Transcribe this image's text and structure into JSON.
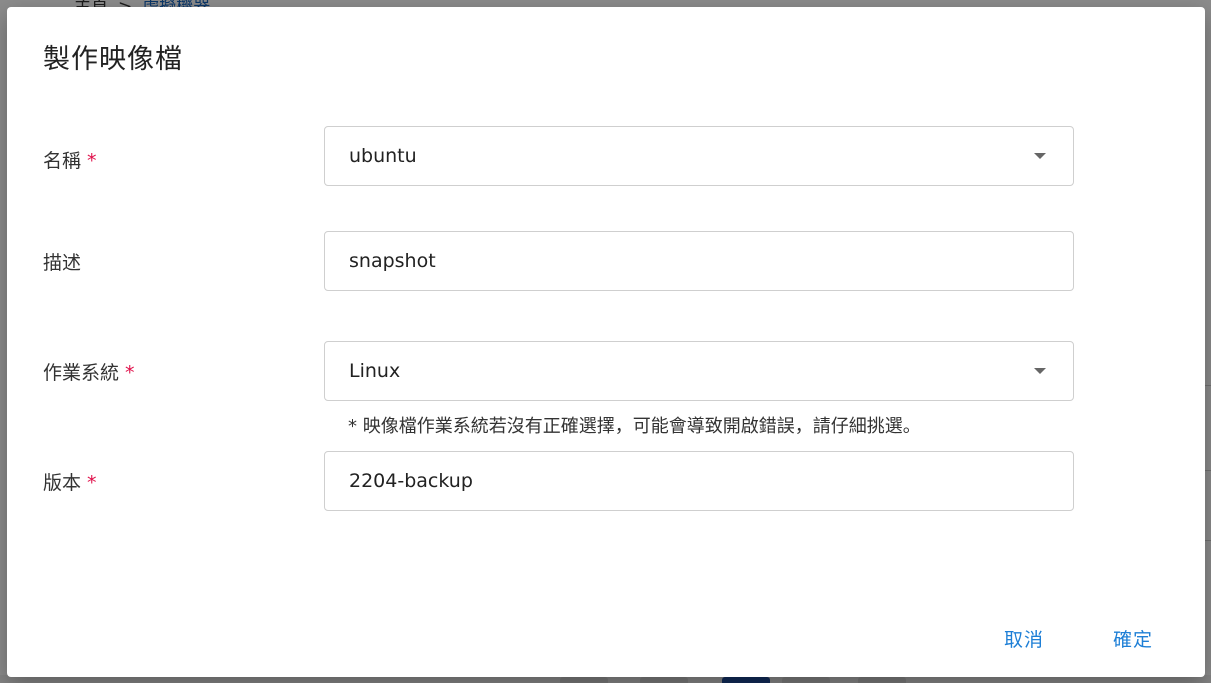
{
  "background": {
    "breadcrumb": {
      "home": "主頁",
      "separator": ">",
      "current": "虛擬機器"
    }
  },
  "dialog": {
    "title": "製作映像檔",
    "fields": {
      "name": {
        "label": "名稱",
        "required_mark": "*",
        "value": "ubuntu",
        "icon": "chevron-down-icon"
      },
      "description": {
        "label": "描述",
        "value": "snapshot"
      },
      "os": {
        "label": "作業系統",
        "required_mark": "*",
        "value": "Linux",
        "icon": "chevron-down-icon",
        "hint": "* 映像檔作業系統若沒有正確選擇，可能會導致開啟錯誤，請仔細挑選。"
      },
      "version": {
        "label": "版本",
        "required_mark": "*",
        "value": "2204-backup"
      }
    },
    "actions": {
      "cancel_label": "取消",
      "confirm_label": "確定"
    }
  },
  "colors": {
    "required": "#e0104a",
    "action": "#1e7fd6",
    "border": "#cfcfcf"
  }
}
